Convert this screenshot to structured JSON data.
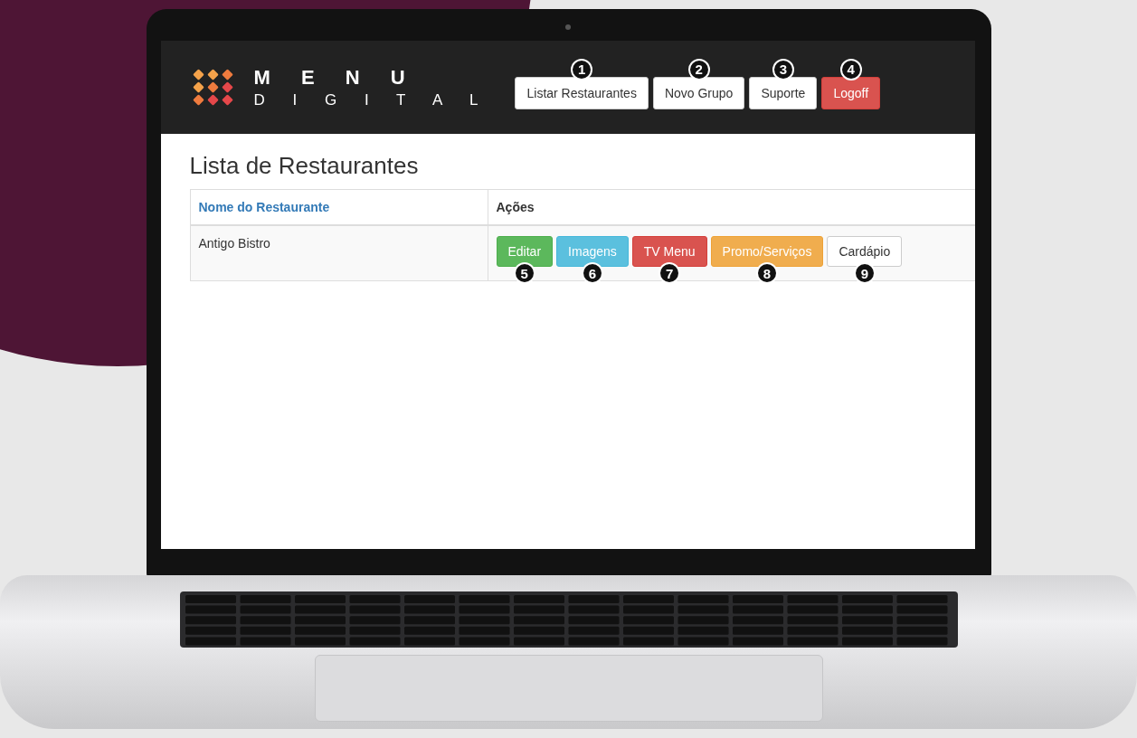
{
  "logo": {
    "line_1": "M E N U",
    "line_2": "D I G I T A L"
  },
  "nav_buttons": [
    {
      "label": "Listar Restaurantes",
      "kind": "default",
      "badge": "1"
    },
    {
      "label": "Novo Grupo",
      "kind": "default",
      "badge": "2"
    },
    {
      "label": "Suporte",
      "kind": "default",
      "badge": "3"
    },
    {
      "label": "Logoff",
      "kind": "danger",
      "badge": "4"
    }
  ],
  "page_title": "Lista de Restaurantes",
  "table": {
    "columns": [
      "Nome do Restaurante",
      "Ações"
    ],
    "rows": [
      {
        "name": "Antigo Bistro",
        "actions": [
          {
            "label": "Editar",
            "kind": "success",
            "badge": "5"
          },
          {
            "label": "Imagens",
            "kind": "info",
            "badge": "6"
          },
          {
            "label": "TV Menu",
            "kind": "danger",
            "badge": "7"
          },
          {
            "label": "Promo/Serviços",
            "kind": "warning",
            "badge": "8"
          },
          {
            "label": "Cardápio",
            "kind": "default",
            "badge": "9"
          }
        ]
      }
    ]
  }
}
